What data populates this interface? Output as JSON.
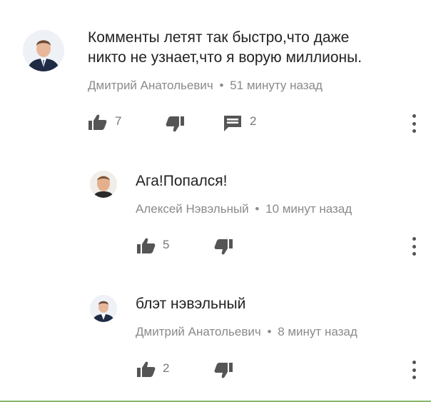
{
  "comments": [
    {
      "text_line1": "Комменты летят так быстро,что даже",
      "text_line2": "никто не узнает,что я ворую миллионы.",
      "author": "Дмитрий Анатольевич",
      "separator": "•",
      "time": "51 минуту назад",
      "likes": "7",
      "replies": "2",
      "avatar_icon": "person-suit-icon"
    },
    {
      "text": "Ага!Попался!",
      "author": "Алексей Нэвэльный",
      "separator": "•",
      "time": "10 минут назад",
      "likes": "5",
      "avatar_icon": "person-face-icon"
    },
    {
      "text": "блэт нэвэльный",
      "author": "Дмитрий Анатольевич",
      "separator": "•",
      "time": "8 минут назад",
      "likes": "2",
      "avatar_icon": "person-suit-icon"
    }
  ],
  "colors": {
    "icon": "#555555",
    "meta_text": "#8a8a8a",
    "border": "#86b86a"
  }
}
